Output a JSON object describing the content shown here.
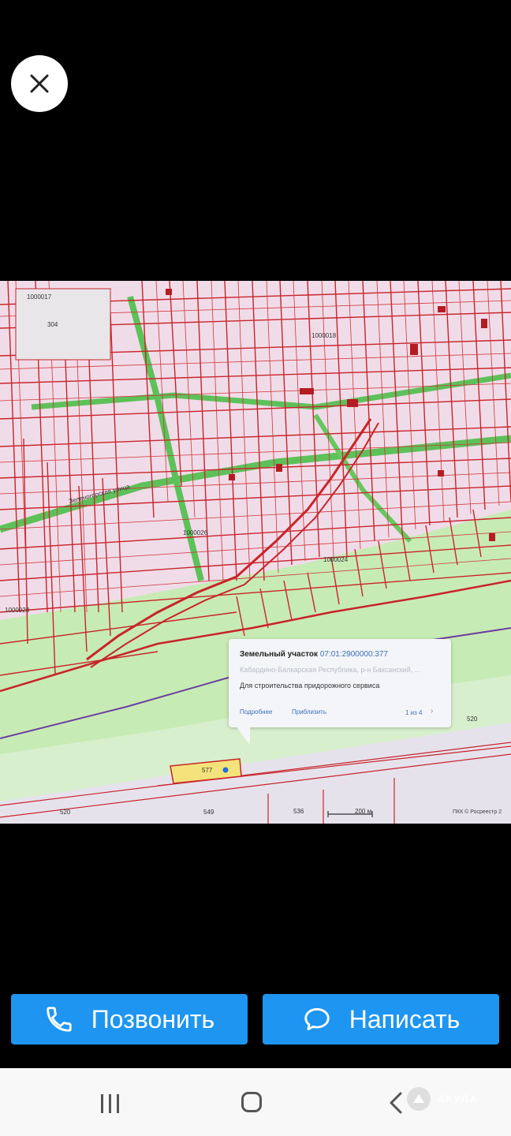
{
  "close_icon": "close-icon",
  "map": {
    "labels": {
      "l1000017": "1000017",
      "l304": "304",
      "l1000018": "1000018",
      "l1000026": "1000026",
      "l1000024": "1000024",
      "l1000028": "1000028",
      "street": "Зеленогорская улица",
      "l549": "549",
      "l536": "536",
      "l520a": "520",
      "l520b": "520",
      "l577": "577"
    }
  },
  "popup": {
    "title": "Земельный участок",
    "cadastral": "07:01:2900000:377",
    "address": "Кабардино-Балкарская Республика, р-н Баксанский, ...",
    "purpose": "Для строительства придорожного сервиса",
    "more_link": "Подробнее",
    "zoom_link": "Приблизить",
    "count": "1 из 4",
    "next_icon": "chevron-right-icon"
  },
  "scale": "200 м",
  "attribution": "ПКК © Росреестр 2",
  "buttons": {
    "call_label": "Позвонить",
    "message_label": "Написать"
  },
  "watermark": "АКУЛА",
  "colors": {
    "accent": "#1e95f1",
    "parcel_red": "#c8242a",
    "zone_green": "#b9e7a6"
  }
}
